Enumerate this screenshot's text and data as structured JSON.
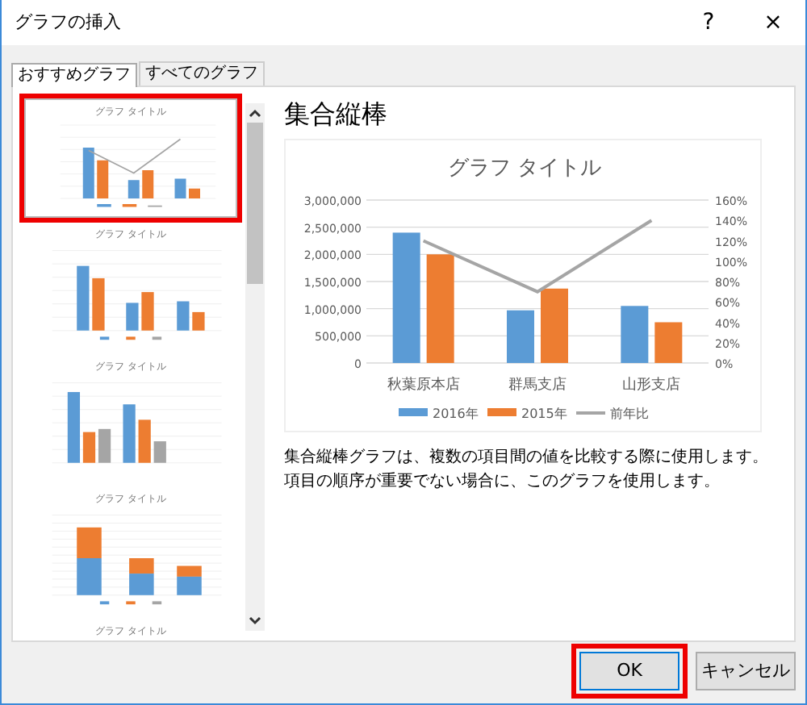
{
  "window": {
    "title": "グラフの挿入",
    "help": "?",
    "close": "×"
  },
  "tabs": [
    {
      "label": "おすすめグラフ",
      "selected": true
    },
    {
      "label": "すべてのグラフ",
      "selected": false
    }
  ],
  "thumbnails": [
    {
      "kind": "combo",
      "title": "グラフ タイトル",
      "selected": true
    },
    {
      "kind": "clustered",
      "title": "グラフ タイトル",
      "selected": false
    },
    {
      "kind": "byseries",
      "title": "グラフ タイトル",
      "selected": false
    },
    {
      "kind": "stacked",
      "title": "グラフ タイトル",
      "selected": false
    },
    {
      "kind": "cut",
      "title": "グラフ タイトル",
      "selected": false
    }
  ],
  "preview": {
    "heading": "集合縦棒",
    "chart_data": {
      "type": "bar",
      "title": "グラフ タイトル",
      "categories": [
        "秋葉原本店",
        "群馬支店",
        "山形支店"
      ],
      "series": [
        {
          "name": "2016年",
          "color": "#5b9bd5",
          "values": [
            2400000,
            970000,
            1050000
          ],
          "type": "bar"
        },
        {
          "name": "2015年",
          "color": "#ed7d31",
          "values": [
            2000000,
            1370000,
            750000
          ],
          "type": "bar"
        },
        {
          "name": "前年比",
          "color": "#a5a5a5",
          "values": [
            1.2,
            0.7,
            1.4
          ],
          "type": "line",
          "axis": "y2"
        }
      ],
      "grid": true,
      "legend": "bottom",
      "ylim": [
        0,
        3000000
      ],
      "yticks": [
        {
          "value": 0,
          "label": "0"
        },
        {
          "value": 500000,
          "label": "500,000"
        },
        {
          "value": 1000000,
          "label": "1,000,000"
        },
        {
          "value": 1500000,
          "label": "1,500,000"
        },
        {
          "value": 2000000,
          "label": "2,000,000"
        },
        {
          "value": 2500000,
          "label": "2,500,000"
        },
        {
          "value": 3000000,
          "label": "3,000,000"
        }
      ],
      "y2lim": [
        0,
        1.6
      ],
      "y2ticks": [
        {
          "value": 0,
          "label": "0%"
        },
        {
          "value": 0.2,
          "label": "20%"
        },
        {
          "value": 0.4,
          "label": "40%"
        },
        {
          "value": 0.6,
          "label": "60%"
        },
        {
          "value": 0.8,
          "label": "80%"
        },
        {
          "value": 1,
          "label": "100%"
        },
        {
          "value": 1.2,
          "label": "120%"
        },
        {
          "value": 1.4,
          "label": "140%"
        },
        {
          "value": 1.6,
          "label": "160%"
        }
      ]
    },
    "description": "集合縦棒グラフは、複数の項目間の値を比較する際に使用します。項目の順序が重要でない場合に、このグラフを使用します。"
  },
  "buttons": [
    {
      "label": "OK",
      "highlighted": true
    },
    {
      "label": "キャンセル",
      "highlighted": false
    }
  ]
}
